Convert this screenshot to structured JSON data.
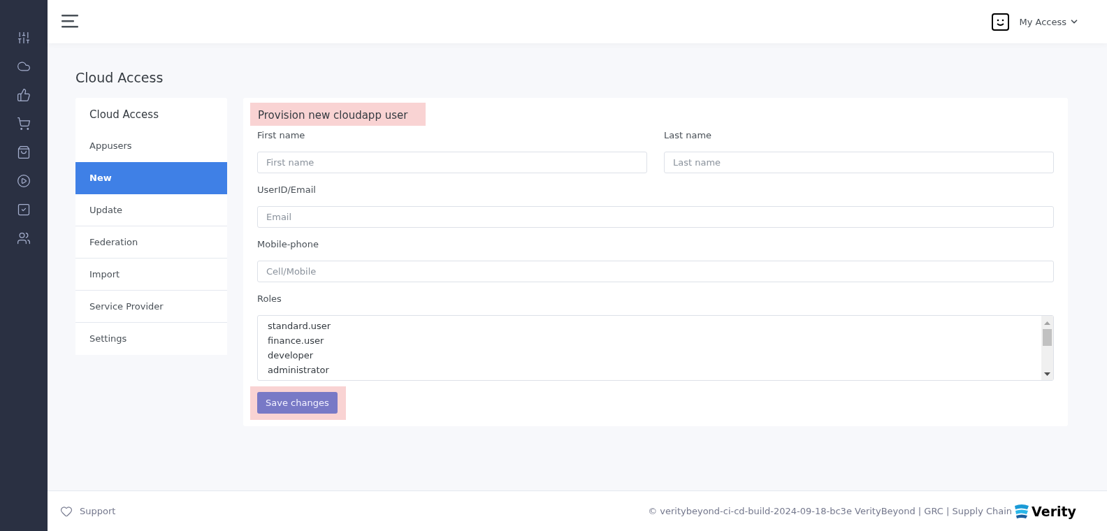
{
  "header": {
    "account_menu": "My Access"
  },
  "page_title": "Cloud Access",
  "nav": {
    "title": "Cloud Access",
    "items": [
      {
        "label": "Appusers",
        "selected": false
      },
      {
        "label": "New",
        "selected": true
      },
      {
        "label": "Update",
        "selected": false
      },
      {
        "label": "Federation",
        "selected": false
      },
      {
        "label": "Import",
        "selected": false
      },
      {
        "label": "Service Provider",
        "selected": false
      },
      {
        "label": "Settings",
        "selected": false
      }
    ]
  },
  "form": {
    "title": "Provision new cloudapp user",
    "first_name": {
      "label": "First name",
      "placeholder": "First name"
    },
    "last_name": {
      "label": "Last name",
      "placeholder": "Last name"
    },
    "email": {
      "label": "UserID/Email",
      "placeholder": "Email"
    },
    "phone": {
      "label": "Mobile-phone",
      "placeholder": "Cell/Mobile"
    },
    "roles": {
      "label": "Roles",
      "options": [
        "standard.user",
        "finance.user",
        "developer",
        "administrator"
      ]
    },
    "submit": "Save changes"
  },
  "footer": {
    "support": "Support",
    "copyright": "© veritybeyond-ci-cd-build-2024-09-18-bc3e VerityBeyond | GRC | Supply Chain",
    "logo_text": "Verity"
  }
}
